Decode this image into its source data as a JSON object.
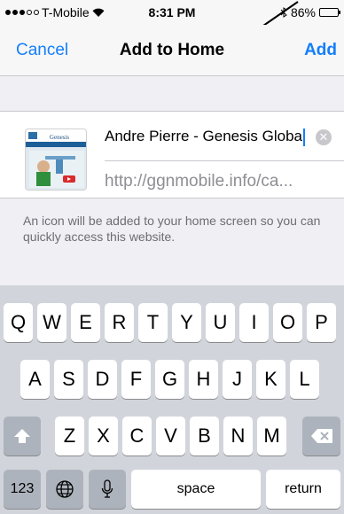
{
  "status_bar": {
    "carrier": "T-Mobile",
    "time": "8:31 PM",
    "battery": "86%",
    "battery_level": 0.86
  },
  "nav": {
    "cancel_label": "Cancel",
    "title": "Add to Home",
    "add_label": "Add"
  },
  "bookmark": {
    "name_value": "Andre Pierre - Genesis Globa",
    "url": "http://ggnmobile.info/ca...",
    "thumbnail_logo_text": "Genesis"
  },
  "info_text": "An icon will be added to your home screen so you can quickly access this website.",
  "keyboard": {
    "row1": [
      "Q",
      "W",
      "E",
      "R",
      "T",
      "Y",
      "U",
      "I",
      "O",
      "P"
    ],
    "row2": [
      "A",
      "S",
      "D",
      "F",
      "G",
      "H",
      "J",
      "K",
      "L"
    ],
    "row3": [
      "Z",
      "X",
      "C",
      "V",
      "B",
      "N",
      "M"
    ],
    "numbers_label": "123",
    "space_label": "space",
    "return_label": "return"
  },
  "colors": {
    "accent": "#147efb",
    "keyboard_bg": "#d1d5db",
    "dark_key": "#adb3bc"
  }
}
